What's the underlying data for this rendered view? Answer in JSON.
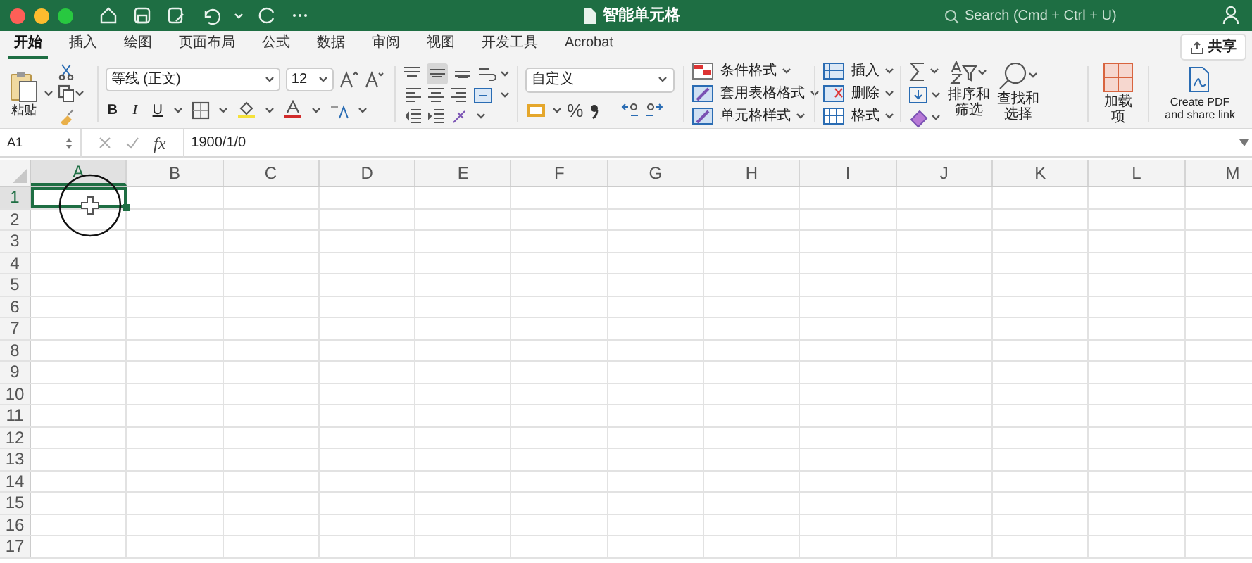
{
  "window": {
    "title": "智能单元格",
    "search_placeholder": "Search (Cmd + Ctrl + U)"
  },
  "tabs": [
    {
      "label": "开始",
      "selected": true
    },
    {
      "label": "插入",
      "selected": false
    },
    {
      "label": "绘图",
      "selected": false
    },
    {
      "label": "页面布局",
      "selected": false
    },
    {
      "label": "公式",
      "selected": false
    },
    {
      "label": "数据",
      "selected": false
    },
    {
      "label": "审阅",
      "selected": false
    },
    {
      "label": "视图",
      "selected": false
    },
    {
      "label": "开发工具",
      "selected": false
    },
    {
      "label": "Acrobat",
      "selected": false
    }
  ],
  "share_button": "共享",
  "ribbon": {
    "paste": "粘贴",
    "font_name": "等线 (正文)",
    "font_size": "12",
    "bold": "B",
    "italic": "I",
    "underline": "U",
    "vertical_align": [
      {
        "selected": false
      },
      {
        "selected": true
      },
      {
        "selected": false
      }
    ],
    "number_format": "自定义",
    "percent": "%",
    "styles": [
      "条件格式",
      "套用表格格式",
      "单元格样式"
    ],
    "cells": [
      "插入",
      "删除",
      "格式"
    ],
    "sort_filter": "排序和筛选",
    "find_select": "查找和选择",
    "add_ins": "加载项",
    "create_pdf": "Create PDF\nand share link"
  },
  "formula_bar": {
    "name_box": "A1",
    "function_label": "fx",
    "formula": "1900/1/0"
  },
  "grid": {
    "columns": [
      {
        "label": "A",
        "selected": true
      },
      {
        "label": "B",
        "selected": false
      },
      {
        "label": "C",
        "selected": false
      },
      {
        "label": "D",
        "selected": false
      },
      {
        "label": "E",
        "selected": false
      },
      {
        "label": "F",
        "selected": false
      },
      {
        "label": "G",
        "selected": false
      },
      {
        "label": "H",
        "selected": false
      },
      {
        "label": "I",
        "selected": false
      },
      {
        "label": "J",
        "selected": false
      },
      {
        "label": "K",
        "selected": false
      },
      {
        "label": "L",
        "selected": false
      },
      {
        "label": "M",
        "selected": false
      }
    ],
    "rows": [
      {
        "label": "1",
        "selected": true
      },
      {
        "label": "2",
        "selected": false
      },
      {
        "label": "3",
        "selected": false
      },
      {
        "label": "4",
        "selected": false
      },
      {
        "label": "5",
        "selected": false
      },
      {
        "label": "6",
        "selected": false
      },
      {
        "label": "7",
        "selected": false
      },
      {
        "label": "8",
        "selected": false
      },
      {
        "label": "9",
        "selected": false
      },
      {
        "label": "10",
        "selected": false
      },
      {
        "label": "11",
        "selected": false
      },
      {
        "label": "12",
        "selected": false
      },
      {
        "label": "13",
        "selected": false
      },
      {
        "label": "14",
        "selected": false
      },
      {
        "label": "15",
        "selected": false
      },
      {
        "label": "16",
        "selected": false
      },
      {
        "label": "17",
        "selected": false
      }
    ]
  }
}
